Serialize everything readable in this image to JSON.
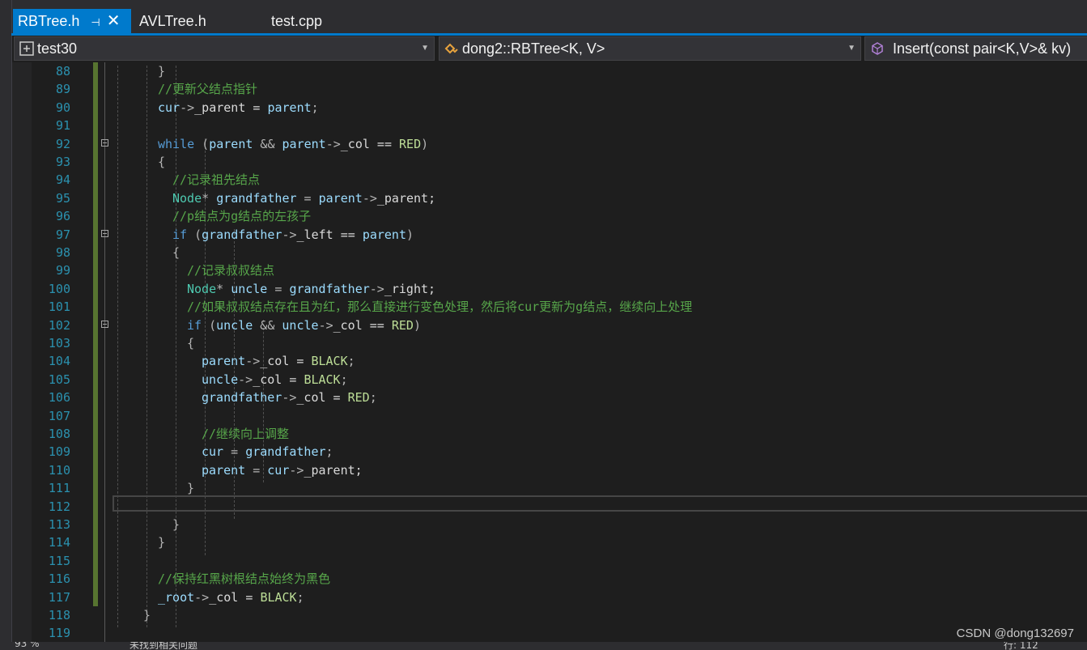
{
  "tabs": [
    {
      "label": "RBTree.h",
      "active": true
    },
    {
      "label": "AVLTree.h",
      "active": false
    },
    {
      "label": "test.cpp",
      "active": false
    }
  ],
  "nav": {
    "project": "test30",
    "scope": "dong2::RBTree<K, V>",
    "member": "Insert(const pair<K,V>& kv)"
  },
  "lines": [
    {
      "n": "88",
      "indent": 6,
      "changed": true,
      "tokens": [
        [
          "op",
          "}"
        ]
      ]
    },
    {
      "n": "89",
      "indent": 6,
      "changed": true,
      "tokens": [
        [
          "cm",
          "//更新父结点指针"
        ]
      ]
    },
    {
      "n": "90",
      "indent": 6,
      "changed": true,
      "tokens": [
        [
          "var",
          "cur"
        ],
        [
          "op",
          "->"
        ],
        [
          "fld",
          "_parent = "
        ],
        [
          "var",
          "parent"
        ],
        [
          "op",
          ";"
        ]
      ]
    },
    {
      "n": "91",
      "indent": 0,
      "changed": true,
      "tokens": []
    },
    {
      "n": "92",
      "indent": 6,
      "changed": true,
      "fold": true,
      "tokens": [
        [
          "kw",
          "while"
        ],
        [
          "op",
          " ("
        ],
        [
          "var",
          "parent"
        ],
        [
          "op",
          " && "
        ],
        [
          "var",
          "parent"
        ],
        [
          "op",
          "->"
        ],
        [
          "fld",
          "_col == "
        ],
        [
          "mac",
          "RED"
        ],
        [
          "op",
          ")"
        ]
      ]
    },
    {
      "n": "93",
      "indent": 6,
      "changed": true,
      "tokens": [
        [
          "op",
          "{"
        ]
      ]
    },
    {
      "n": "94",
      "indent": 8,
      "changed": true,
      "tokens": [
        [
          "cm",
          "//记录祖先结点"
        ]
      ]
    },
    {
      "n": "95",
      "indent": 8,
      "changed": true,
      "tokens": [
        [
          "tp",
          "Node"
        ],
        [
          "op",
          "* "
        ],
        [
          "var",
          "grandfather"
        ],
        [
          "op",
          " = "
        ],
        [
          "var",
          "parent"
        ],
        [
          "op",
          "->"
        ],
        [
          "fld",
          "_parent;"
        ]
      ]
    },
    {
      "n": "96",
      "indent": 8,
      "changed": true,
      "tokens": [
        [
          "cm",
          "//p结点为g结点的左孩子"
        ]
      ]
    },
    {
      "n": "97",
      "indent": 8,
      "changed": true,
      "fold": true,
      "tokens": [
        [
          "kw",
          "if"
        ],
        [
          "op",
          " ("
        ],
        [
          "var",
          "grandfather"
        ],
        [
          "op",
          "->"
        ],
        [
          "fld",
          "_left == "
        ],
        [
          "var",
          "parent"
        ],
        [
          "op",
          ")"
        ]
      ]
    },
    {
      "n": "98",
      "indent": 8,
      "changed": true,
      "tokens": [
        [
          "op",
          "{"
        ]
      ]
    },
    {
      "n": "99",
      "indent": 10,
      "changed": true,
      "tokens": [
        [
          "cm",
          "//记录叔叔结点"
        ]
      ]
    },
    {
      "n": "100",
      "indent": 10,
      "changed": true,
      "tokens": [
        [
          "tp",
          "Node"
        ],
        [
          "op",
          "* "
        ],
        [
          "var",
          "uncle"
        ],
        [
          "op",
          " = "
        ],
        [
          "var",
          "grandfather"
        ],
        [
          "op",
          "->"
        ],
        [
          "fld",
          "_right;"
        ]
      ]
    },
    {
      "n": "101",
      "indent": 10,
      "changed": true,
      "tokens": [
        [
          "cm",
          "//如果叔叔结点存在且为红，那么直接进行变色处理，然后将cur更新为g结点，继续向上处理"
        ]
      ]
    },
    {
      "n": "102",
      "indent": 10,
      "changed": true,
      "fold": true,
      "tokens": [
        [
          "kw",
          "if"
        ],
        [
          "op",
          " ("
        ],
        [
          "var",
          "uncle"
        ],
        [
          "op",
          " && "
        ],
        [
          "var",
          "uncle"
        ],
        [
          "op",
          "->"
        ],
        [
          "fld",
          "_col == "
        ],
        [
          "mac",
          "RED"
        ],
        [
          "op",
          ")"
        ]
      ]
    },
    {
      "n": "103",
      "indent": 10,
      "changed": true,
      "tokens": [
        [
          "op",
          "{"
        ]
      ]
    },
    {
      "n": "104",
      "indent": 12,
      "changed": true,
      "tokens": [
        [
          "var",
          "parent"
        ],
        [
          "op",
          "->"
        ],
        [
          "fld",
          "_col = "
        ],
        [
          "mac",
          "BLACK"
        ],
        [
          "op",
          ";"
        ]
      ]
    },
    {
      "n": "105",
      "indent": 12,
      "changed": true,
      "tokens": [
        [
          "var",
          "uncle"
        ],
        [
          "op",
          "->"
        ],
        [
          "fld",
          "_col = "
        ],
        [
          "mac",
          "BLACK"
        ],
        [
          "op",
          ";"
        ]
      ]
    },
    {
      "n": "106",
      "indent": 12,
      "changed": true,
      "tokens": [
        [
          "var",
          "grandfather"
        ],
        [
          "op",
          "->"
        ],
        [
          "fld",
          "_col = "
        ],
        [
          "mac",
          "RED"
        ],
        [
          "op",
          ";"
        ]
      ]
    },
    {
      "n": "107",
      "indent": 0,
      "changed": true,
      "tokens": []
    },
    {
      "n": "108",
      "indent": 12,
      "changed": true,
      "tokens": [
        [
          "cm",
          "//继续向上调整"
        ]
      ]
    },
    {
      "n": "109",
      "indent": 12,
      "changed": true,
      "tokens": [
        [
          "var",
          "cur"
        ],
        [
          "op",
          " = "
        ],
        [
          "var",
          "grandfather"
        ],
        [
          "op",
          ";"
        ]
      ]
    },
    {
      "n": "110",
      "indent": 12,
      "changed": true,
      "tokens": [
        [
          "var",
          "parent"
        ],
        [
          "op",
          " = "
        ],
        [
          "var",
          "cur"
        ],
        [
          "op",
          "->"
        ],
        [
          "fld",
          "_parent;"
        ]
      ]
    },
    {
      "n": "111",
      "indent": 10,
      "changed": true,
      "tokens": [
        [
          "op",
          "}"
        ]
      ]
    },
    {
      "n": "112",
      "indent": 0,
      "changed": true,
      "tokens": []
    },
    {
      "n": "113",
      "indent": 8,
      "changed": true,
      "tokens": [
        [
          "op",
          "}"
        ]
      ]
    },
    {
      "n": "114",
      "indent": 6,
      "changed": true,
      "tokens": [
        [
          "op",
          "}"
        ]
      ]
    },
    {
      "n": "115",
      "indent": 0,
      "changed": true,
      "tokens": []
    },
    {
      "n": "116",
      "indent": 6,
      "changed": true,
      "tokens": [
        [
          "cm",
          "//保持红黑树根结点始终为黑色"
        ]
      ]
    },
    {
      "n": "117",
      "indent": 6,
      "changed": true,
      "tokens": [
        [
          "var",
          "_root"
        ],
        [
          "op",
          "->"
        ],
        [
          "fld",
          "_col = "
        ],
        [
          "mac",
          "BLACK"
        ],
        [
          "op",
          ";"
        ]
      ]
    },
    {
      "n": "118",
      "indent": 4,
      "changed": false,
      "tokens": [
        [
          "op",
          "}"
        ]
      ]
    },
    {
      "n": "119",
      "indent": 0,
      "changed": false,
      "tokens": []
    }
  ],
  "status": {
    "zoom": "93 %",
    "issues": "未找到相关问题",
    "position": "行: 112"
  },
  "watermark": "CSDN @dong132697",
  "colors": {
    "accent": "#007acc",
    "change_bar": "#577430",
    "line_number": "#2b91af",
    "comment": "#57a64a",
    "keyword": "#569cd6"
  }
}
